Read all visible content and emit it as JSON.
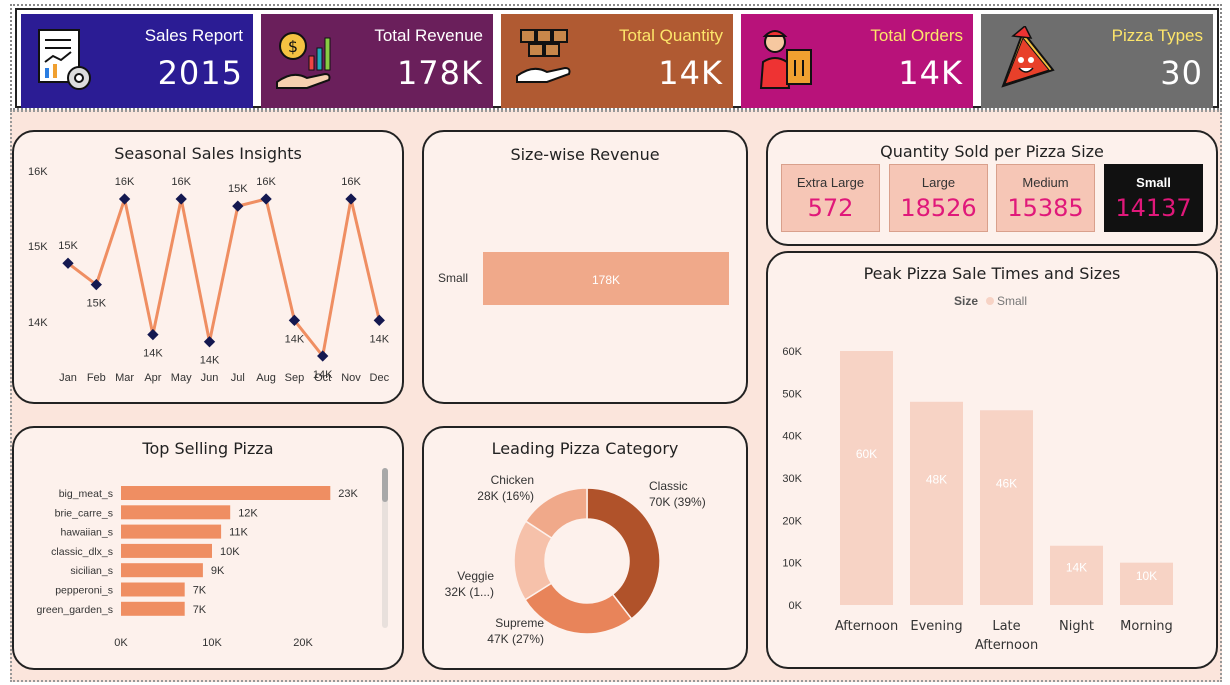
{
  "kpis": [
    {
      "title": "Sales Report",
      "value": "2015",
      "color": "#2b1c94",
      "icon": "report-icon"
    },
    {
      "title": "Total Revenue",
      "value": "178K",
      "color": "#6a1f5b",
      "icon": "revenue-icon"
    },
    {
      "title": "Total Quantity",
      "value": "14K",
      "color": "#b05a32",
      "icon": "boxes-icon"
    },
    {
      "title": "Total Orders",
      "value": "14K",
      "color": "#b8127a",
      "icon": "delivery-icon"
    },
    {
      "title": "Pizza Types",
      "value": "30",
      "color": "#6e6e6e",
      "icon": "pizza-icon"
    }
  ],
  "seasonal": {
    "title": "Seasonal Sales Insights",
    "y_ticks": [
      "16K",
      "15K",
      "14K"
    ],
    "chart_data": {
      "type": "line",
      "categories": [
        "Jan",
        "Feb",
        "Mar",
        "Apr",
        "May",
        "Jun",
        "Jul",
        "Aug",
        "Sep",
        "Oct",
        "Nov",
        "Dec"
      ],
      "values": [
        15.1,
        14.8,
        16.0,
        14.1,
        16.0,
        14.0,
        15.9,
        16.0,
        14.3,
        13.8,
        16.0,
        14.3
      ],
      "labels": [
        "15K",
        "15K",
        "16K",
        "14K",
        "16K",
        "14K",
        "15K",
        "16K",
        "14K",
        "14K",
        "16K",
        "14K"
      ],
      "color": "#ef8e62",
      "marker_color": "#141850"
    }
  },
  "size_revenue": {
    "title": "Size-wise Revenue",
    "chart_data": {
      "type": "bar",
      "categories": [
        "Small"
      ],
      "values": [
        178
      ],
      "labels": [
        "178K"
      ],
      "color": "#f0a98a"
    }
  },
  "qty_size": {
    "title": "Quantity Sold per Pizza Size",
    "items": [
      {
        "label": "Extra Large",
        "value": "572"
      },
      {
        "label": "Large",
        "value": "18526"
      },
      {
        "label": "Medium",
        "value": "15385"
      },
      {
        "label": "Small",
        "value": "14137"
      }
    ]
  },
  "peak": {
    "title": "Peak Pizza Sale Times and Sizes",
    "legend_title": "Size",
    "legend_item": "Small",
    "y_ticks": [
      "60K",
      "50K",
      "40K",
      "30K",
      "20K",
      "10K",
      "0K"
    ],
    "chart_data": {
      "type": "bar",
      "categories": [
        "Afternoon",
        "Evening",
        "Late Afternoon",
        "Night",
        "Morning"
      ],
      "values": [
        60,
        48,
        46,
        14,
        10
      ],
      "labels": [
        "60K",
        "48K",
        "46K",
        "14K",
        "10K"
      ],
      "ylim": [
        0,
        60
      ],
      "color": "#f7d3c5"
    }
  },
  "top_selling": {
    "title": "Top Selling Pizza",
    "x_ticks": [
      "0K",
      "10K",
      "20K"
    ],
    "chart_data": {
      "type": "bar",
      "categories": [
        "big_meat_s",
        "brie_carre_s",
        "hawaiian_s",
        "classic_dlx_s",
        "sicilian_s",
        "pepperoni_s",
        "green_garden_s"
      ],
      "values": [
        23,
        12,
        11,
        10,
        9,
        7,
        7
      ],
      "labels": [
        "23K",
        "12K",
        "11K",
        "10K",
        "9K",
        "7K",
        "7K"
      ],
      "xlim": [
        0,
        25
      ],
      "color": "#ef8e62"
    }
  },
  "category": {
    "title": "Leading Pizza Category",
    "chart_data": {
      "type": "pie",
      "categories": [
        "Classic",
        "Supreme",
        "Veggie",
        "Chicken"
      ],
      "values": [
        70,
        47,
        32,
        28
      ],
      "labels": [
        "70K (39%)",
        "47K (27%)",
        "32K (1...)",
        "28K (16%)"
      ],
      "colors": [
        "#b0522a",
        "#e8845a",
        "#f6c1aa",
        "#f0a98a"
      ]
    }
  }
}
